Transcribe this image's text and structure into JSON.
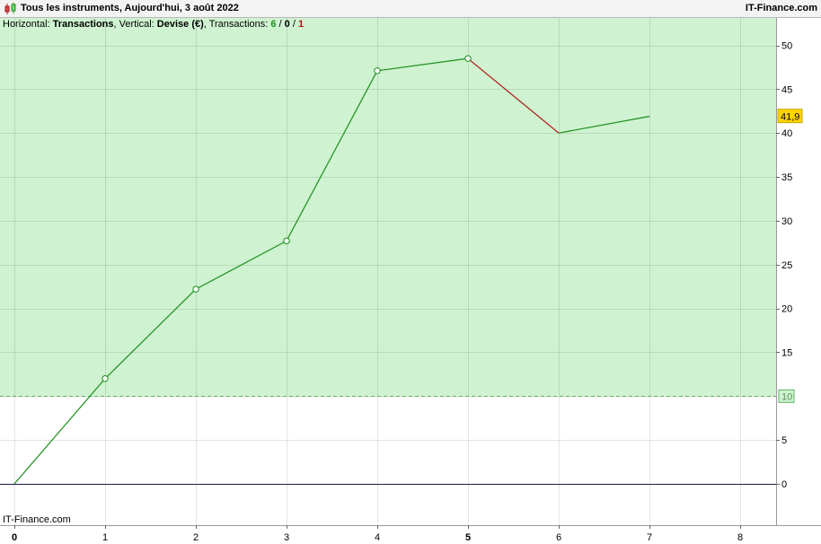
{
  "window": {
    "title": "Tous les instruments, Aujourd'hui, 3 août 2022",
    "brand": "IT-Finance.com"
  },
  "info_line": {
    "horizontal_label": "Horizontal: ",
    "horizontal_value": "Transactions",
    "vertical_label": ", Vertical: ",
    "vertical_value": "Devise (€)",
    "transactions_label": ", Transactions: ",
    "count_total": "6",
    "sep1": " / ",
    "count_neutral": "0",
    "sep2": " / ",
    "count_loss": "1"
  },
  "watermark": "IT-Finance.com",
  "colors": {
    "gain": "#1a8f1a",
    "loss": "#b01515",
    "zone_fill": "#cff2d1",
    "baseline": "#1b1b4a",
    "last_label_bg": "#ffd400",
    "threshold": "#5fb35f"
  },
  "chart_data": {
    "type": "line",
    "x": [
      0,
      1,
      2,
      3,
      4,
      5,
      6,
      7
    ],
    "y": [
      0,
      12.0,
      22.2,
      27.7,
      47.1,
      48.5,
      40.0,
      41.9
    ],
    "x_ticks": [
      "0",
      "1",
      "2",
      "3",
      "4",
      "5",
      "6",
      "7",
      "8"
    ],
    "y_ticks": [
      "0",
      "5",
      "10",
      "15",
      "20",
      "25",
      "30",
      "35",
      "40",
      "45",
      "50"
    ],
    "xlim": [
      0,
      8.4
    ],
    "ylim": [
      -4.5,
      54.5
    ],
    "threshold": 10,
    "threshold_label": "10",
    "last_value_label": "41,9",
    "grid": true
  }
}
